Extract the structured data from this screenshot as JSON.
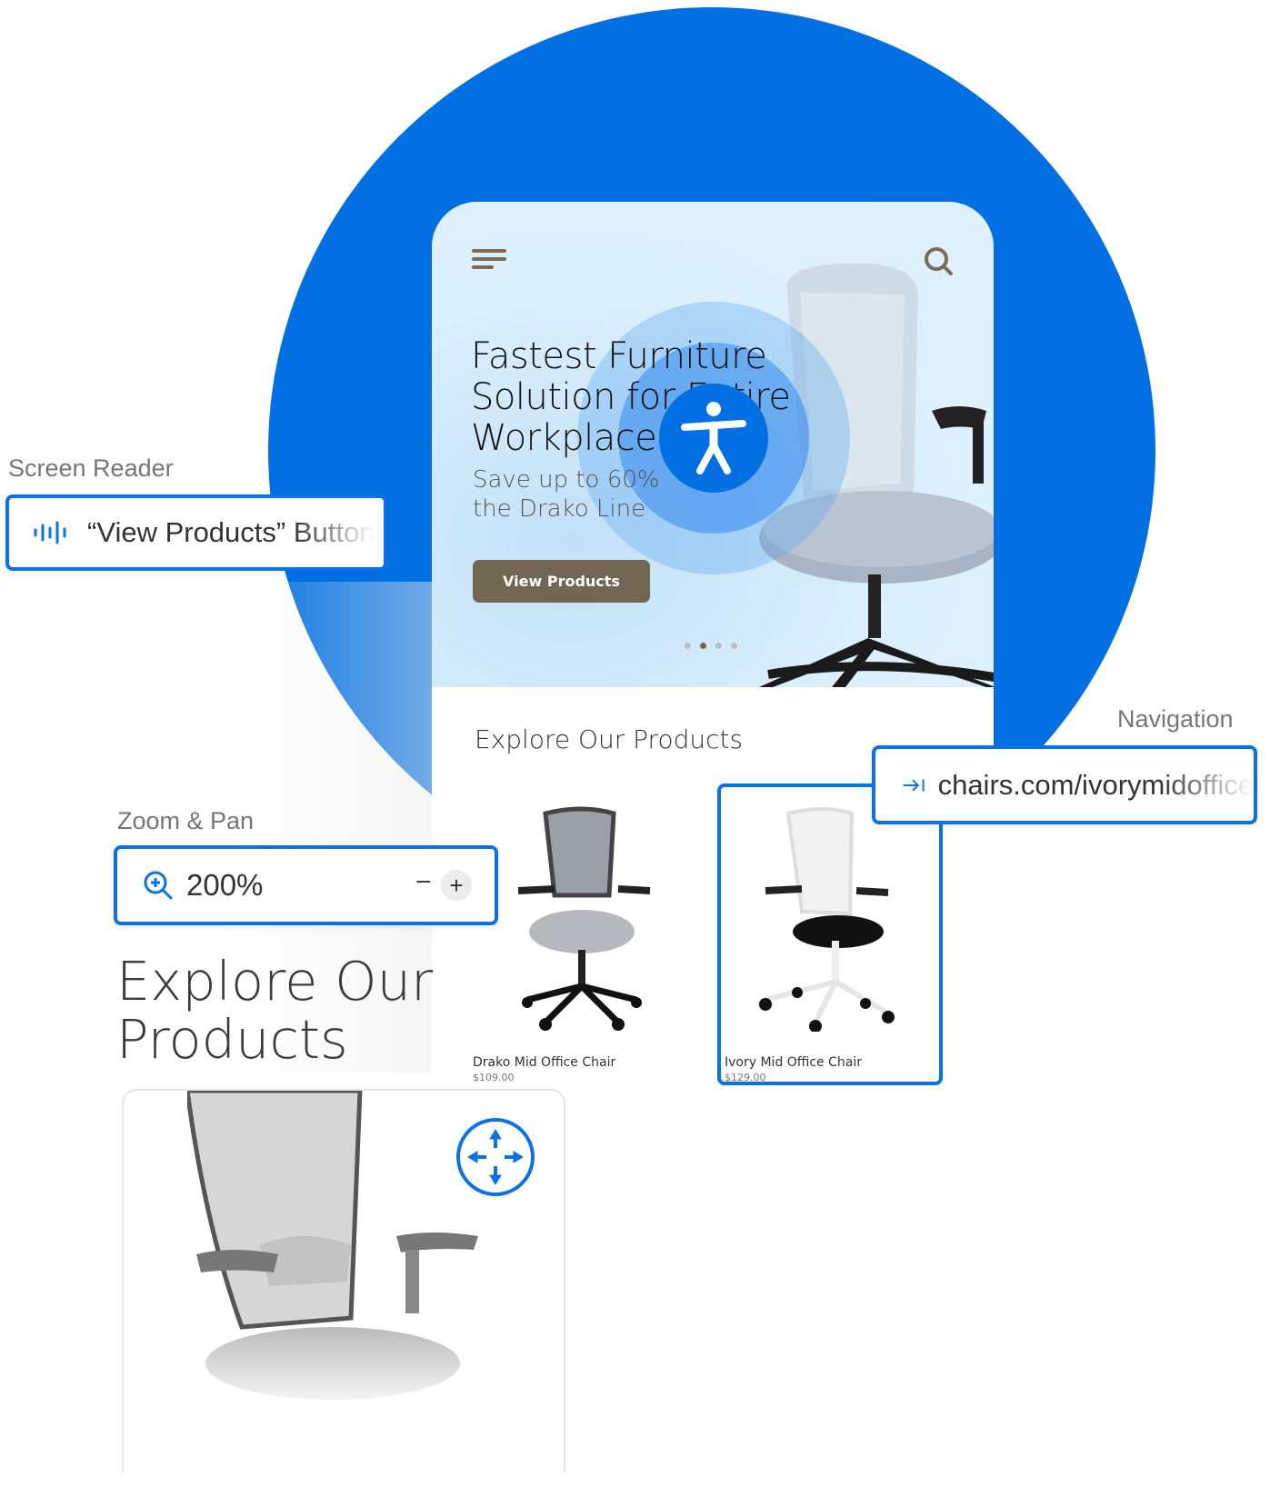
{
  "colors": {
    "accent": "#0270e3",
    "button": "#716652",
    "hero_bg": "#dcf0fc"
  },
  "hero": {
    "title_lines": [
      "Fastest Furniture",
      "Solution for Entire",
      "Workplace"
    ],
    "subtitle_lines": [
      "Save up to 60%",
      "the Drako Line"
    ],
    "cta_label": "View Products",
    "carousel": {
      "total": 4,
      "active": 2
    },
    "menu_icon": "hamburger-icon",
    "search_icon": "search-icon"
  },
  "phone": {
    "section_title": "Explore Our Products",
    "products": [
      {
        "name": "Drako Mid Office Chair",
        "price": "$109.00"
      },
      {
        "name": "Ivory Mid Office Chair",
        "price": "$129.00"
      }
    ]
  },
  "callouts": {
    "screen_reader": {
      "label": "Screen Reader",
      "text": "“View Products” Button",
      "icon": "audio-wave-icon"
    },
    "navigation": {
      "label": "Navigation",
      "text": "chairs.com/ivorymidoffice",
      "icon": "tab-arrow-icon"
    },
    "zoom": {
      "label": "Zoom & Pan",
      "value": "200%",
      "minus": "−",
      "plus": "+",
      "icon": "zoom-in-icon"
    }
  },
  "zoomed": {
    "title_lines": [
      "Explore Our",
      "Products"
    ],
    "pan_icon": "move-arrows-icon"
  },
  "accessibility_icon": "accessibility-person-icon"
}
